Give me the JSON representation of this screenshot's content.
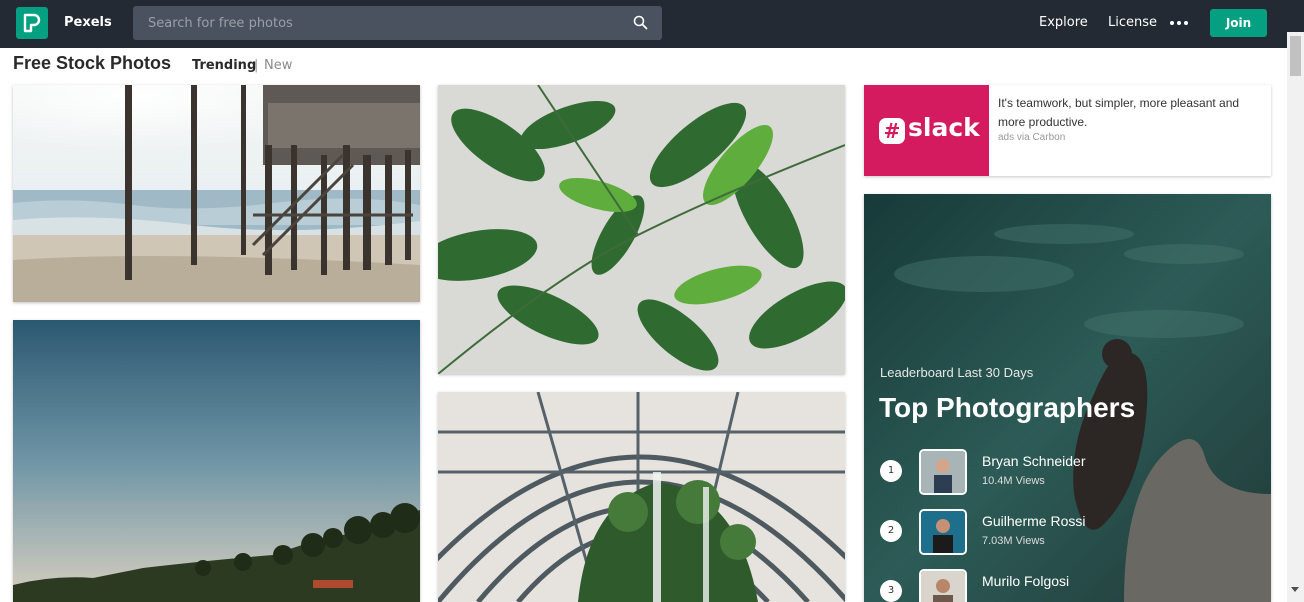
{
  "header": {
    "brand": "Pexels",
    "search_placeholder": "Search for free photos",
    "nav": {
      "explore": "Explore",
      "license": "License"
    },
    "join": "Join",
    "accent_color": "#05a081",
    "bar_color": "#232a34"
  },
  "heading": {
    "title": "Free Stock Photos",
    "tab_trending": "Trending",
    "separator": "|",
    "tab_new": "New"
  },
  "ad": {
    "brand": "slack",
    "hash_glyph": "#",
    "text": "It's teamwork, but simpler, more pleasant and more productive.",
    "via": "ads via Carbon",
    "brand_color": "#d41b5f"
  },
  "leaderboard": {
    "subtitle": "Leaderboard Last 30 Days",
    "title": "Top Photographers",
    "photographers": [
      {
        "rank": "1",
        "name": "Bryan Schneider",
        "views": "10.4M Views"
      },
      {
        "rank": "2",
        "name": "Guilherme Rossi",
        "views": "7.03M Views"
      },
      {
        "rank": "3",
        "name": "Murilo Folgosi",
        "views": ""
      }
    ]
  },
  "icons": {
    "logo": "pexels-logo-icon",
    "search": "search-icon",
    "more": "more-dots-icon"
  }
}
